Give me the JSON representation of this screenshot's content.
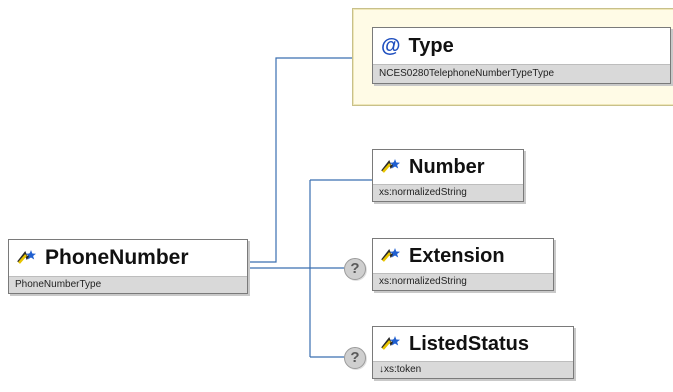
{
  "root": {
    "name": "PhoneNumber",
    "type": "PhoneNumberType",
    "icon": "element-icon"
  },
  "attributes": [
    {
      "name": "Type",
      "type": "NCES0280TelephoneNumberTypeType",
      "icon": "at-icon",
      "symbol": "@"
    }
  ],
  "elements": [
    {
      "name": "Number",
      "type": "xs:normalizedString",
      "optional": false
    },
    {
      "name": "Extension",
      "type": "xs:normalizedString",
      "optional": true
    },
    {
      "name": "ListedStatus",
      "type": "↓xs:token",
      "optional": true
    }
  ],
  "optional_symbol": "?",
  "colors": {
    "connector": "#3a6fb0",
    "attr_group_bg": "#fffbe6",
    "type_bar": "#d9d9d9",
    "at_symbol": "#1f4fbf"
  }
}
